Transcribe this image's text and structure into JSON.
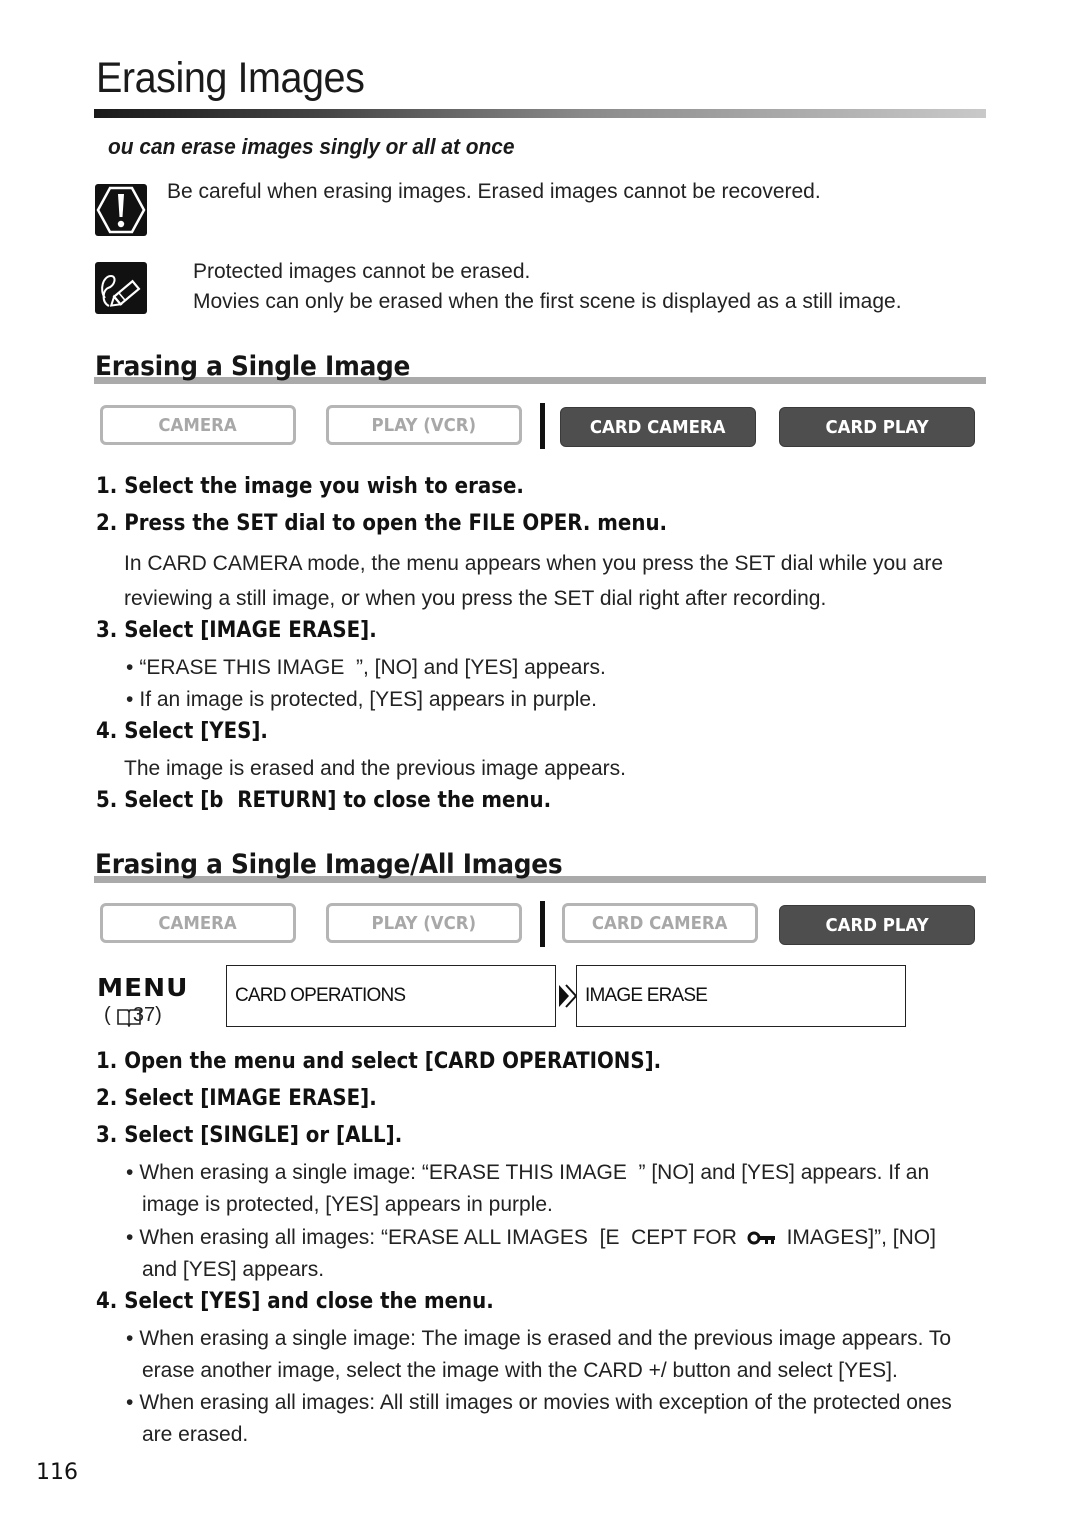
{
  "page": {
    "title": "Erasing Images",
    "subtitle": "ou can erase images singly or all at once",
    "page_number": "116"
  },
  "notices": {
    "caution": {
      "icon": "caution-icon",
      "text": "Be careful when erasing images. Erased images cannot be recovered."
    },
    "note": {
      "icon": "note-pencil-icon",
      "lines": [
        "Protected images cannot be erased.",
        "Movies can only be erased when the first scene is displayed as a still image."
      ]
    }
  },
  "section1": {
    "title": "Erasing a Single Image",
    "modes": [
      {
        "label": "CAMERA",
        "active": false
      },
      {
        "label": "PLAY (VCR)",
        "active": false
      },
      {
        "label": "CARD CAMERA",
        "active": true
      },
      {
        "label": "CARD PLAY",
        "active": true
      }
    ],
    "steps": [
      {
        "text": "1. Select the image you wish to erase."
      },
      {
        "text": "2. Press the SET dial to open the FILE OPER. menu.",
        "details": [
          "In CARD CAMERA mode, the menu appears when you press the SET dial while you are",
          "reviewing a still image, or when you press the SET dial right after recording."
        ]
      },
      {
        "text": "3. Select [IMAGE ERASE].",
        "bullets": [
          "“ERASE THIS IMAGE  ”, [NO] and [YES] appears.",
          "If an image is protected, [YES] appears in purple."
        ]
      },
      {
        "text": "4. Select [YES].",
        "details": [
          "The image is erased and the previous image appears."
        ]
      },
      {
        "text": "5. Select [b  RETURN] to close the menu."
      }
    ]
  },
  "section2": {
    "title": "Erasing a Single Image/All Images",
    "modes": [
      {
        "label": "CAMERA",
        "active": false
      },
      {
        "label": "PLAY (VCR)",
        "active": false
      },
      {
        "label": "CARD CAMERA",
        "active": false
      },
      {
        "label": "CARD PLAY",
        "active": true
      }
    ],
    "menu": {
      "label": "MENU",
      "reference": "(    37)",
      "reference_icon": "book-icon",
      "path": [
        "CARD OPERATIONS",
        "IMAGE ERASE"
      ],
      "arrow_icon": "double-chevron-right-icon"
    },
    "steps": [
      {
        "text": "1. Open the menu and select [CARD OPERATIONS]."
      },
      {
        "text": "2. Select [IMAGE ERASE]."
      },
      {
        "text": "3. Select [SINGLE] or [ALL].",
        "bullets": [
          [
            "When erasing a single image: “ERASE THIS IMAGE  ” [NO] and [YES] appears. If an",
            "image is protected, [YES] appears in purple."
          ],
          [
            "When erasing all images: “ERASE ALL IMAGES  [E  CEPT FOR",
            "IMAGES]”, [NO]",
            "and [YES] appears."
          ]
        ]
      },
      {
        "text": "4. Select [YES] and close the menu.",
        "bullets": [
          [
            "When erasing a single image: The image is erased and the previous image appears. To",
            "erase another image, select the image with the CARD +/ button and select [YES]."
          ],
          [
            "When erasing all images: All still images or movies with exception of the protected ones",
            "are erased."
          ]
        ]
      }
    ]
  },
  "colors": {
    "active_mode_bg": "#4e4e4e",
    "inactive_mode_border": "#b5b5b5",
    "section_rule": "#aaaaaa"
  }
}
